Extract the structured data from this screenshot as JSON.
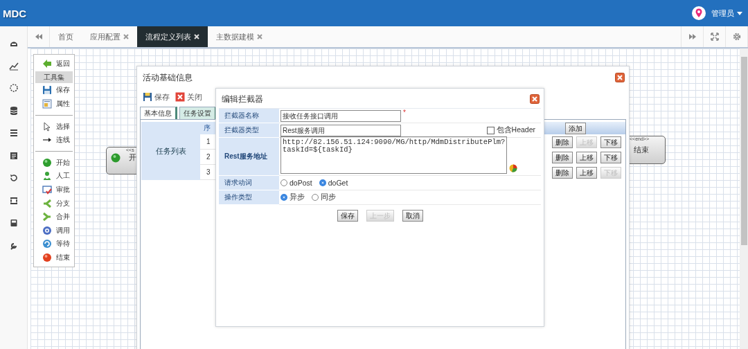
{
  "header": {
    "logo": "MDC",
    "user": "管理员"
  },
  "tabs": [
    {
      "label": "首页",
      "closable": false,
      "selected": false
    },
    {
      "label": "应用配置",
      "closable": true,
      "selected": false
    },
    {
      "label": "流程定义列表",
      "closable": true,
      "selected": true
    },
    {
      "label": "主数据建模",
      "closable": true,
      "selected": false
    }
  ],
  "toolbox": {
    "items": [
      {
        "kind": "tool",
        "label": "返回"
      },
      {
        "kind": "heading",
        "label": "工具集"
      },
      {
        "kind": "tool",
        "label": "保存"
      },
      {
        "kind": "tool",
        "label": "属性"
      },
      {
        "kind": "divider"
      },
      {
        "kind": "tool",
        "label": "选择"
      },
      {
        "kind": "tool",
        "label": "连线"
      },
      {
        "kind": "divider"
      },
      {
        "kind": "tool",
        "label": "开始"
      },
      {
        "kind": "tool",
        "label": "人工"
      },
      {
        "kind": "tool",
        "label": "审批"
      },
      {
        "kind": "tool",
        "label": "分支"
      },
      {
        "kind": "tool",
        "label": "合并"
      },
      {
        "kind": "tool",
        "label": "调用"
      },
      {
        "kind": "tool",
        "label": "等待"
      },
      {
        "kind": "tool",
        "label": "结束"
      }
    ]
  },
  "canvas_nodes": [
    {
      "kind": "start",
      "stereotype": "<<s",
      "label": "开"
    },
    {
      "kind": "end",
      "stereotype": "<<end>>",
      "label": "结束"
    }
  ],
  "activity_dialog": {
    "title": "活动基础信息",
    "toolbar": [
      "保存",
      "关闭"
    ],
    "tabs": [
      {
        "label": "基本信息",
        "selected": false
      },
      {
        "label": "任务设置",
        "selected": true
      }
    ],
    "task_table": {
      "label": "任务列表",
      "seq_header": "序",
      "add_button": "添加",
      "rows": [
        {
          "seq": "1",
          "actions": [
            {
              "label": "删除",
              "disabled": false
            },
            {
              "label": "上移",
              "disabled": true
            },
            {
              "label": "下移",
              "disabled": false
            }
          ]
        },
        {
          "seq": "2",
          "actions": [
            {
              "label": "删除",
              "disabled": false
            },
            {
              "label": "上移",
              "disabled": false
            },
            {
              "label": "下移",
              "disabled": false
            }
          ]
        },
        {
          "seq": "3",
          "actions": [
            {
              "label": "删除",
              "disabled": false
            },
            {
              "label": "上移",
              "disabled": false
            },
            {
              "label": "下移",
              "disabled": true
            }
          ]
        }
      ]
    }
  },
  "interceptor_dialog": {
    "title": "编辑拦截器",
    "fields": [
      {
        "kind": "text",
        "label": "拦截器名称",
        "value": "接收任务接口调用",
        "required_mark": "*"
      },
      {
        "kind": "text",
        "label": "拦截器类型",
        "value": "Rest服务调用",
        "checkbox": {
          "label": "包含Header",
          "checked": false
        }
      },
      {
        "kind": "textarea",
        "label": "Rest服务地址",
        "value": "http://82.156.51.124:9090/MG/http/MdmDistributePlm?taskId=${taskId}"
      },
      {
        "kind": "radio",
        "label": "请求动词",
        "options": [
          {
            "label": "doPost",
            "selected": false
          },
          {
            "label": "doGet",
            "selected": true
          }
        ]
      },
      {
        "kind": "radio",
        "label": "操作类型",
        "options": [
          {
            "label": "异步",
            "selected": true
          },
          {
            "label": "同步",
            "selected": false
          }
        ]
      }
    ],
    "buttons": [
      {
        "label": "保存",
        "disabled": false
      },
      {
        "label": "上一步",
        "disabled": true
      },
      {
        "label": "取消",
        "disabled": false
      }
    ]
  }
}
